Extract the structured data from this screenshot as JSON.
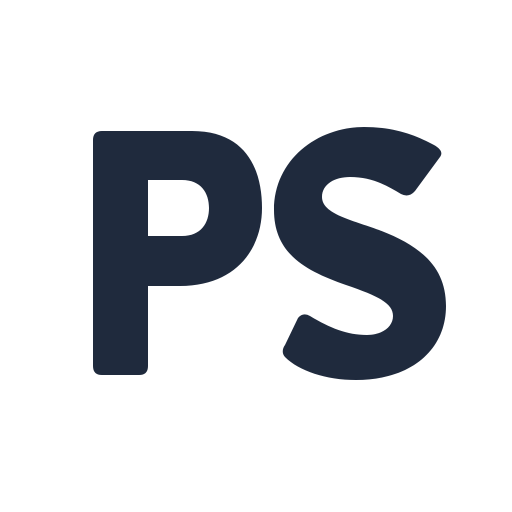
{
  "logo": {
    "text": "PS",
    "color": "#1F2A3D",
    "background": "#FFFFFF",
    "icon": "ps-monogram-icon"
  }
}
